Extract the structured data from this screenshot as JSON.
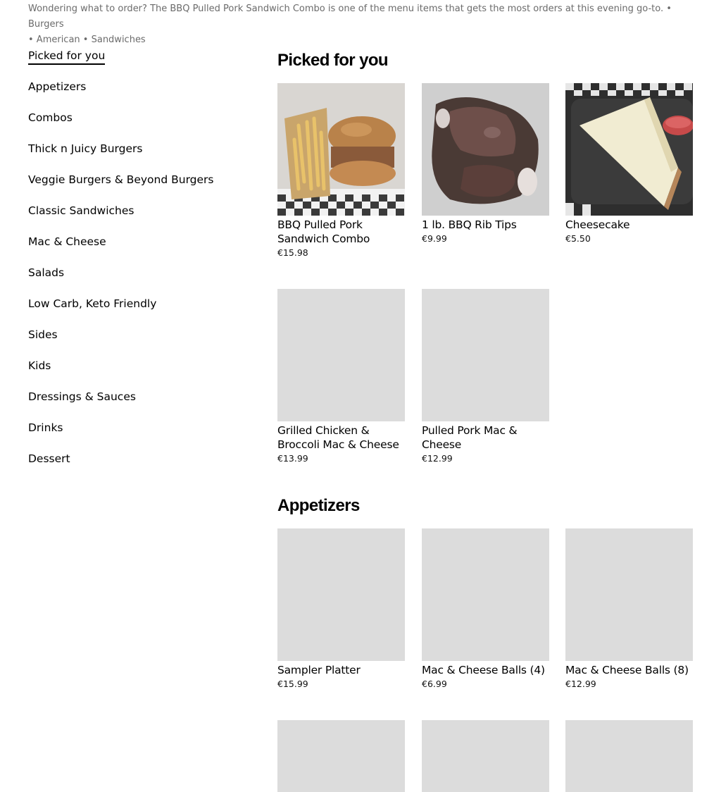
{
  "intro": {
    "text_line1": "Wondering what to order? The BBQ Pulled Pork Sandwich Combo is one of the menu items that gets the most orders at this evening go-to. • Burgers",
    "text_line2": " • American • Sandwiches"
  },
  "sidebar": {
    "items": [
      {
        "label": "Picked for you",
        "active": true
      },
      {
        "label": "Appetizers"
      },
      {
        "label": "Combos"
      },
      {
        "label": "Thick n Juicy Burgers"
      },
      {
        "label": "Veggie Burgers & Beyond Burgers"
      },
      {
        "label": "Classic Sandwiches"
      },
      {
        "label": "Mac & Cheese"
      },
      {
        "label": "Salads"
      },
      {
        "label": "Low Carb, Keto Friendly"
      },
      {
        "label": "Sides"
      },
      {
        "label": "Kids"
      },
      {
        "label": "Dressings & Sauces"
      },
      {
        "label": "Drinks"
      },
      {
        "label": "Dessert"
      }
    ]
  },
  "sections": {
    "picked": {
      "title": "Picked for you",
      "items": [
        {
          "name": "BBQ Pulled Pork Sandwich Combo",
          "price": "€15.98",
          "image": "pulled-pork-sandwich-photo"
        },
        {
          "name": "1 lb. BBQ Rib Tips",
          "price": "€9.99",
          "image": "rib-tips-photo"
        },
        {
          "name": "Cheesecake",
          "price": "€5.50",
          "image": "cheesecake-photo"
        },
        {
          "name": "Grilled Chicken & Broccoli Mac & Cheese",
          "price": "€13.99"
        },
        {
          "name": "Pulled Pork Mac & Cheese",
          "price": "€12.99"
        }
      ]
    },
    "appetizers": {
      "title": "Appetizers",
      "items": [
        {
          "name": "Sampler Platter",
          "price": "€15.99"
        },
        {
          "name": "Mac & Cheese Balls (4)",
          "price": "€6.99"
        },
        {
          "name": "Mac & Cheese Balls (8)",
          "price": "€12.99"
        }
      ]
    }
  },
  "colors": {
    "placeholder": "#dcdcdc",
    "muted_text": "#6b6b6b",
    "text": "#000000"
  }
}
